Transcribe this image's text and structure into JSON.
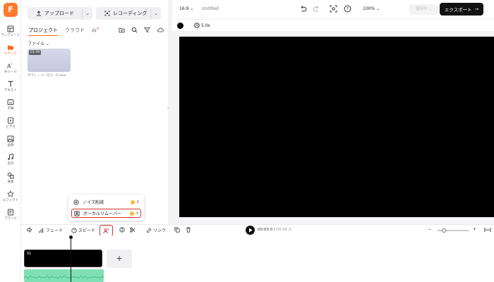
{
  "sidebar": {
    "logo": "F",
    "items": [
      {
        "label": "テンプレート",
        "icon": "template-icon"
      },
      {
        "label": "メディア",
        "icon": "media-folder-icon",
        "active": true
      },
      {
        "label": "AIツール",
        "icon": "ai-tools-icon"
      },
      {
        "label": "テキスト",
        "icon": "text-icon"
      },
      {
        "label": "字幕",
        "icon": "subtitle-icon"
      },
      {
        "label": "ビデオ",
        "icon": "video-icon"
      },
      {
        "label": "画像",
        "icon": "image-icon"
      },
      {
        "label": "音声",
        "icon": "audio-icon"
      },
      {
        "label": "要素",
        "icon": "elements-icon"
      },
      {
        "label": "エフェクト",
        "icon": "effects-icon"
      },
      {
        "label": "ブランド",
        "icon": "brand-icon"
      }
    ]
  },
  "assets": {
    "upload_label": "アップロード",
    "record_label": "レコーディング",
    "tabs": [
      {
        "label": "プロジェクト",
        "active": true
      },
      {
        "label": "クラウド"
      },
      {
        "label": "AI"
      }
    ],
    "filter_label": "ファイル",
    "file": {
      "duration": "01:59",
      "name": "サマー・リーモス...S.mov"
    }
  },
  "topbar": {
    "aspect_ratio": "16:9",
    "title": "Untitled",
    "zoom": "100%",
    "saving_label": "保存中...",
    "export_label": "エクスポート"
  },
  "subbar": {
    "duration": "5.0s"
  },
  "popup": {
    "items": [
      {
        "label": "ノイズ削減",
        "credits": "-3"
      },
      {
        "label": "ボーカルリムーバー",
        "credits": "-3"
      }
    ]
  },
  "timeline_toolbar": {
    "fade_label": "フェード",
    "speed_label": "スピード",
    "link_label": "リンク",
    "current_time": "00:03.0",
    "total_time": "00:05.0"
  },
  "timeline": {
    "clip_label": "01"
  },
  "colors": {
    "accent": "#ff6a1a",
    "highlight": "#d8312b",
    "audio_track": "#7fe0b4",
    "export_bg": "#111111"
  }
}
